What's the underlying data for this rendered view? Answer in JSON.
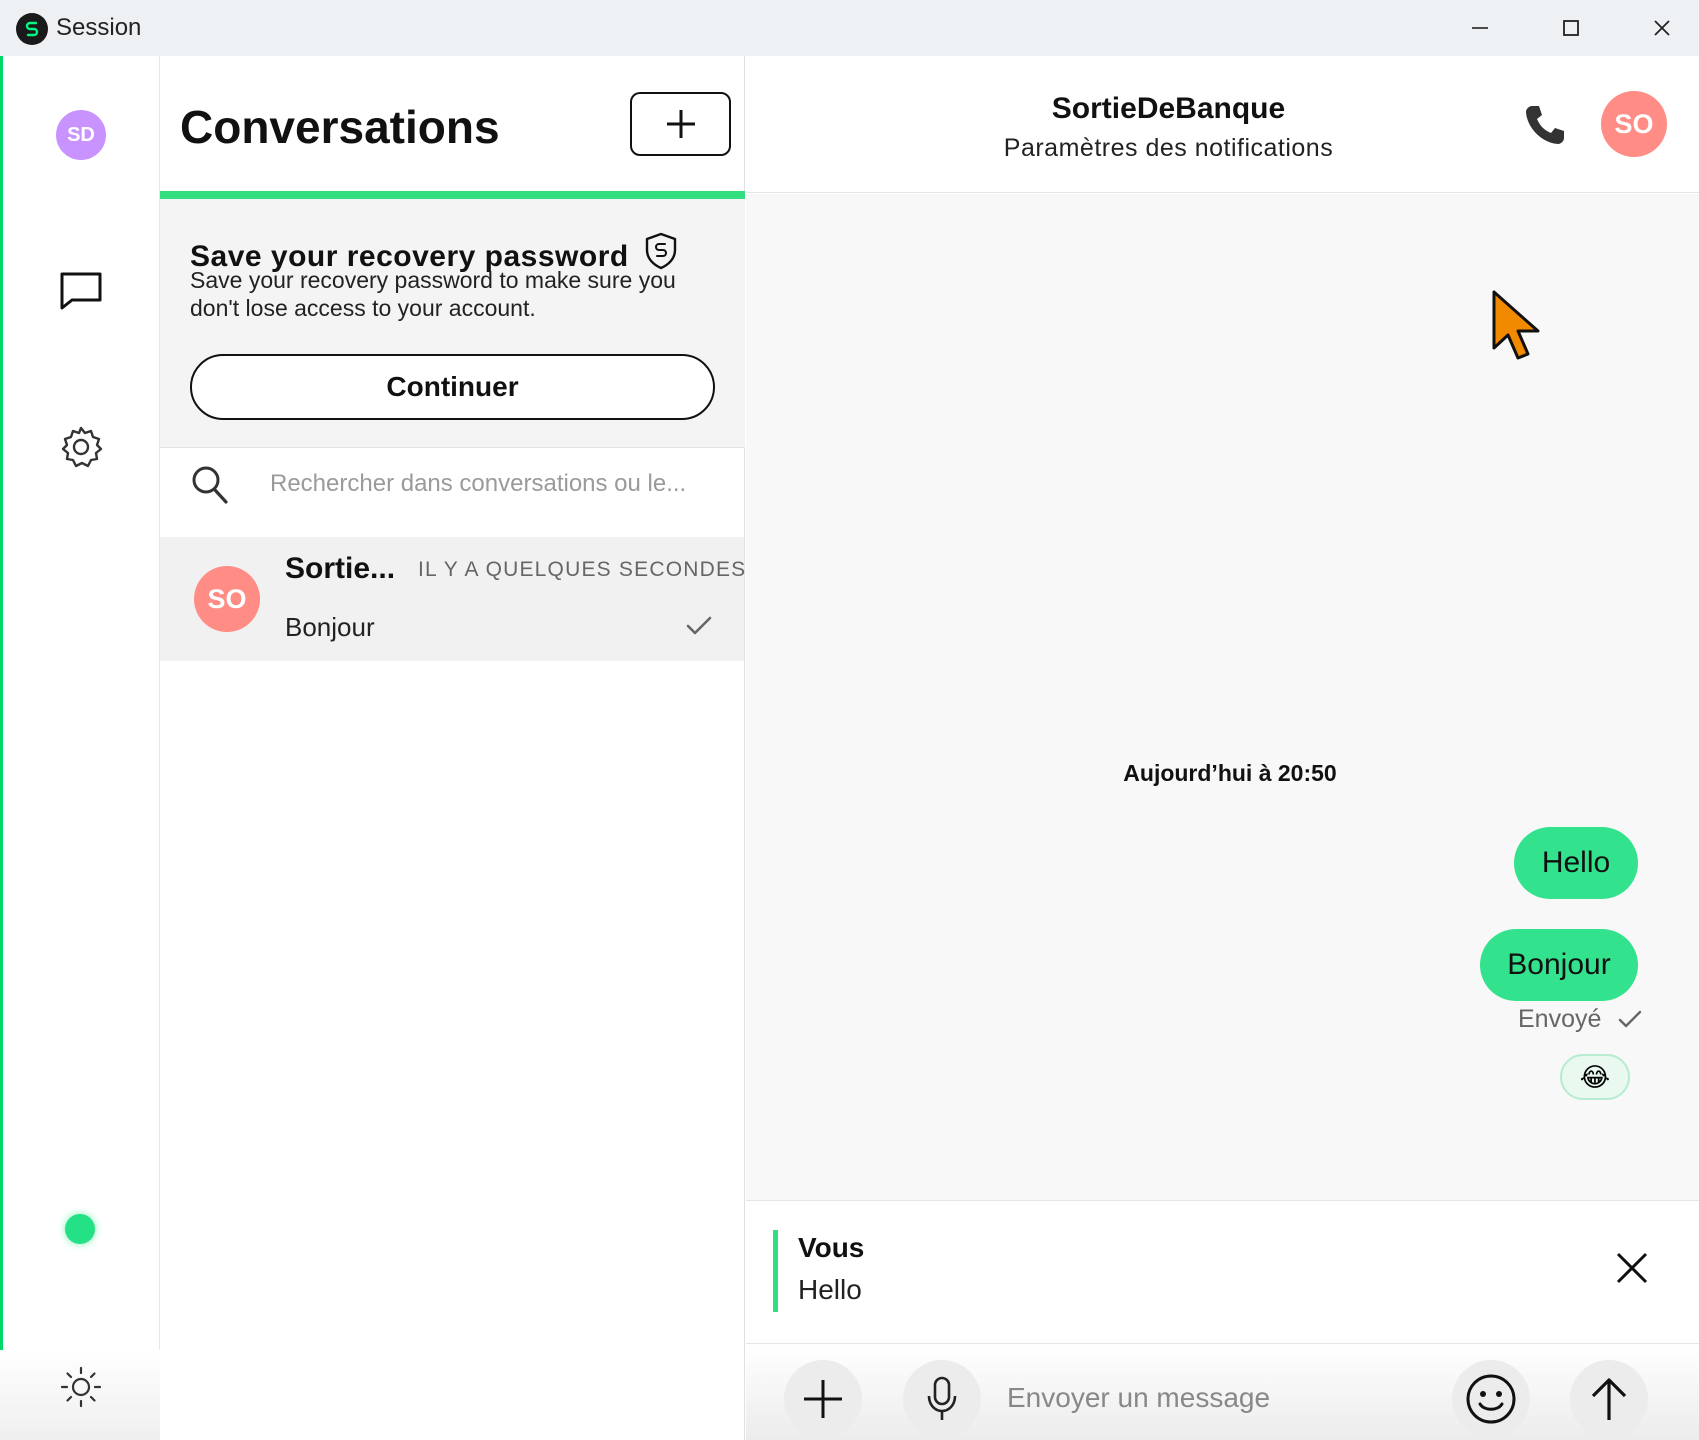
{
  "window": {
    "title": "Session",
    "controls": {
      "minimize": "—",
      "maximize": "☐",
      "close": "✕"
    }
  },
  "rail": {
    "avatar_initials": "SD",
    "avatar_color": "#c993ff",
    "accent_color": "#00d86a",
    "icons": [
      "messages-icon",
      "settings-icon",
      "theme-sun-icon"
    ],
    "online_color": "#23e184"
  },
  "conversations": {
    "title": "Conversations",
    "new_button": "+",
    "recovery": {
      "title": "Save your recovery password",
      "description": "Save your recovery password to make sure you don't lose access to your account.",
      "button": "Continuer"
    },
    "search_placeholder": "Rechercher dans conversations ou le...",
    "items": [
      {
        "avatar_initials": "SO",
        "name": "Sortie...",
        "time": "IL Y A QUELQUES SECONDES",
        "preview": "Bonjour",
        "avatar_color": "#ff8c85"
      }
    ]
  },
  "chat": {
    "contact_name": "SortieDeBanque",
    "subtitle": "Paramètres des notifications",
    "avatar_initials": "SO",
    "date_separator": "Aujourd’hui à 20:50",
    "messages": [
      {
        "text": "Hello",
        "outgoing": true
      },
      {
        "text": "Bonjour",
        "outgoing": true
      }
    ],
    "status": "Envoyé",
    "reaction": "😂",
    "bubble_color": "#33e28d"
  },
  "reply": {
    "author": "Vous",
    "text": "Hello"
  },
  "composer": {
    "placeholder": "Envoyer un message"
  }
}
